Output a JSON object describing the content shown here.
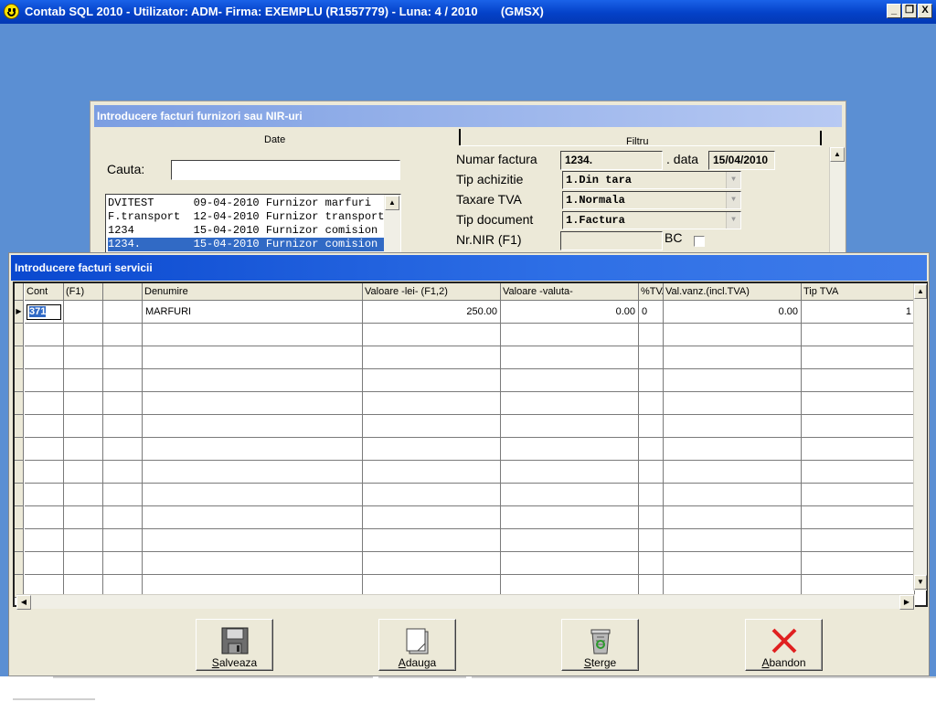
{
  "window": {
    "title": "Contab SQL 2010 - Utilizator: ADM- Firma: EXEMPLU (R1557779) - Luna: 4 / 2010       (GMSX)",
    "controls": [
      "_",
      "❐",
      "X"
    ]
  },
  "nir_dialog": {
    "title": "Introducere facturi furnizori sau NIR-uri",
    "tabs": {
      "date": "Date",
      "filtru": "Filtru"
    },
    "search": {
      "label": "Cauta:",
      "value": ""
    },
    "list": [
      {
        "text": "DVITEST      09-04-2010 Furnizor marfuri"
      },
      {
        "text": "F.transport  12-04-2010 Furnizor transport"
      },
      {
        "text": "1234         15-04-2010 Furnizor comision"
      },
      {
        "text": "1234.        15-04-2010 Furnizor comision"
      }
    ],
    "numar_factura": {
      "label": "Numar factura",
      "value": "1234.",
      "data_label": ". data",
      "data_value": "15/04/2010"
    },
    "tip_achizitie": {
      "label": "Tip achizitie",
      "value": "1.Din tara"
    },
    "taxare_tva": {
      "label": "Taxare TVA",
      "value": "1.Normala"
    },
    "tip_document": {
      "label": "Tip document",
      "value": "1.Factura"
    },
    "nr_nir": {
      "label": "Nr.NIR (F1)",
      "value": "",
      "bc_label": "BC"
    }
  },
  "servicii_dialog": {
    "title": "Introducere facturi servicii",
    "columns": [
      "Cont",
      "(F1)",
      "",
      "Denumire",
      "Valoare -lei- (F1,2)",
      "Valoare -valuta-",
      "%TVA",
      "Val.vanz.(incl.TVA)",
      "Tip TVA"
    ],
    "rows": [
      {
        "cont": "371",
        "f1": "",
        "blank": "",
        "denumire": "MARFURI",
        "valoare_lei": "250.00",
        "valoare_valuta": "0.00",
        "tva": "0",
        "val_vanz": "0.00",
        "tip_tva": "1"
      }
    ],
    "empty_rows": 12,
    "buttons": {
      "save": "Salveaza",
      "add": "Adauga",
      "delete": "Sterge",
      "cancel": "Abandon"
    }
  }
}
